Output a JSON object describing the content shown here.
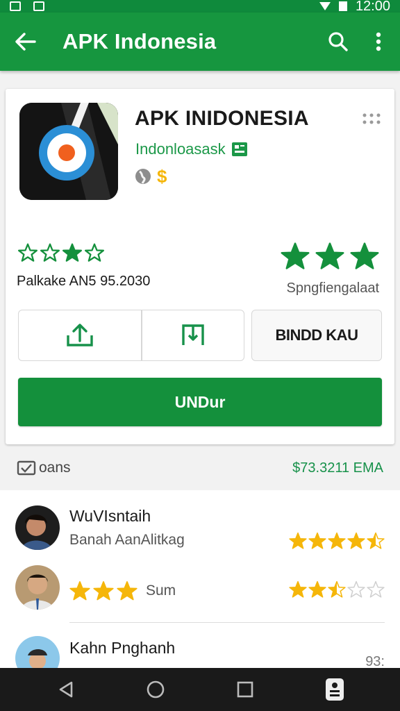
{
  "status_bar": {
    "time": "12:00"
  },
  "app_bar": {
    "title": "APK Indonesia",
    "back_icon": "arrow-back-icon",
    "search_icon": "search-icon",
    "menu_icon": "more-vert-icon"
  },
  "app": {
    "title": "APK INIDONESIA",
    "developer": "Indonloasask",
    "meta_icons": [
      "globe-icon",
      "dollar-icon"
    ],
    "rating_text": "Palkake AN5 95.2030",
    "left_stars": 4,
    "right_stars": 3,
    "review_count_label": "Spngfiengalaat"
  },
  "actions": {
    "share_icon": "share-icon",
    "bookmark_icon": "bookmark-icon",
    "third_label": "BINDD KAU",
    "install_label": "UNDur"
  },
  "section": {
    "label": "oans",
    "price": "$73.3211 EMA"
  },
  "reviews": [
    {
      "name": "WuVIsntaih",
      "subtitle": "Banah AanAlitkag",
      "stars": 4.5
    },
    {
      "name": "",
      "inline_stars": 3,
      "inline_text": "Sum",
      "stars": 2.5
    },
    {
      "name": "Kahn Pnghanh",
      "side_text": "93:"
    }
  ],
  "colors": {
    "status_bar": "#0f8a3c",
    "app_bar": "#16963f",
    "accent_green": "#1b9848",
    "star_gold": "#f5b60a",
    "star_green": "#14903c"
  }
}
